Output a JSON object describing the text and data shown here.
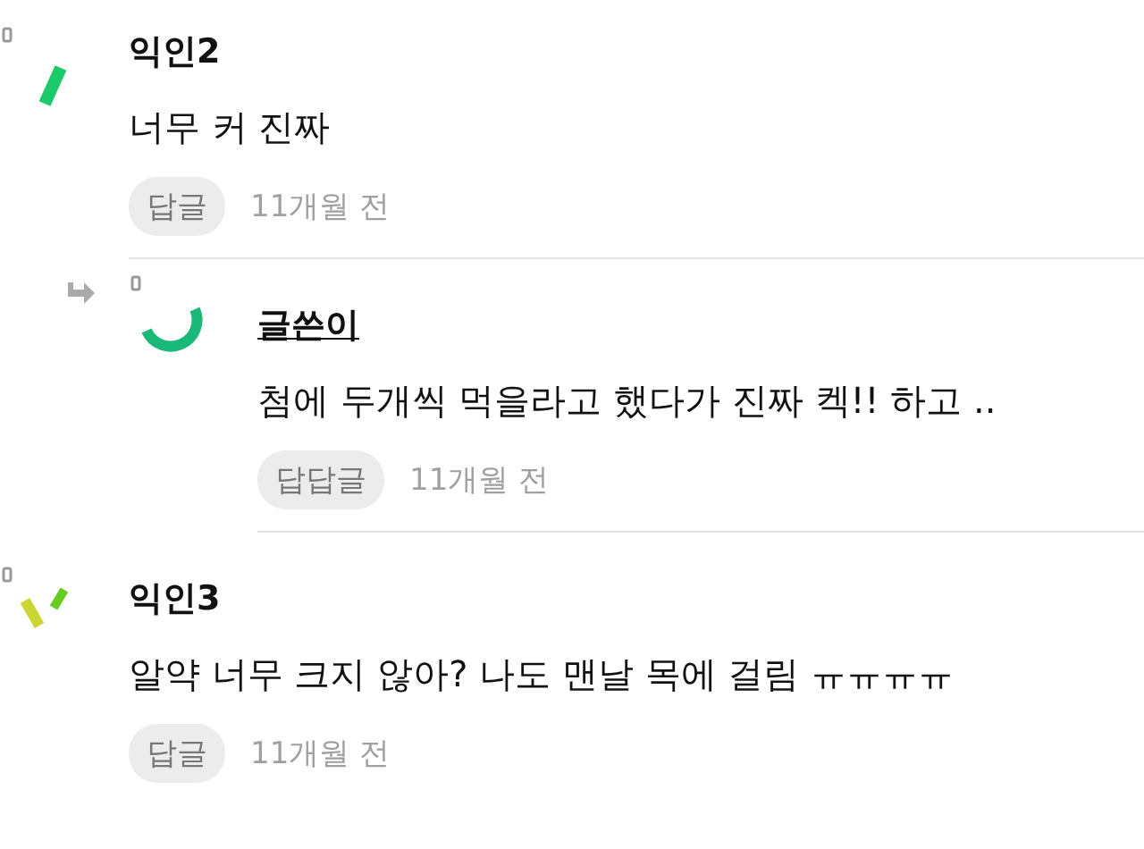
{
  "comments": [
    {
      "kind": "comment",
      "author": "익인2",
      "is_author": false,
      "text": "너무 커 진짜",
      "reply_button": "답글",
      "time": "11개월 전"
    },
    {
      "kind": "reply",
      "author": "글쓴이",
      "is_author": true,
      "text": "첨에 두개씩 먹을라고 했다가 진짜 켁!! 하고 ..",
      "reply_button": "답답글",
      "time": "11개월 전"
    },
    {
      "kind": "comment",
      "author": "익인3",
      "is_author": false,
      "text": "알약 너무 크지 않아? 나도 맨날 목에 걸림 ㅠㅠㅠㅠ",
      "reply_button": "답글",
      "time": "11개월 전"
    }
  ]
}
